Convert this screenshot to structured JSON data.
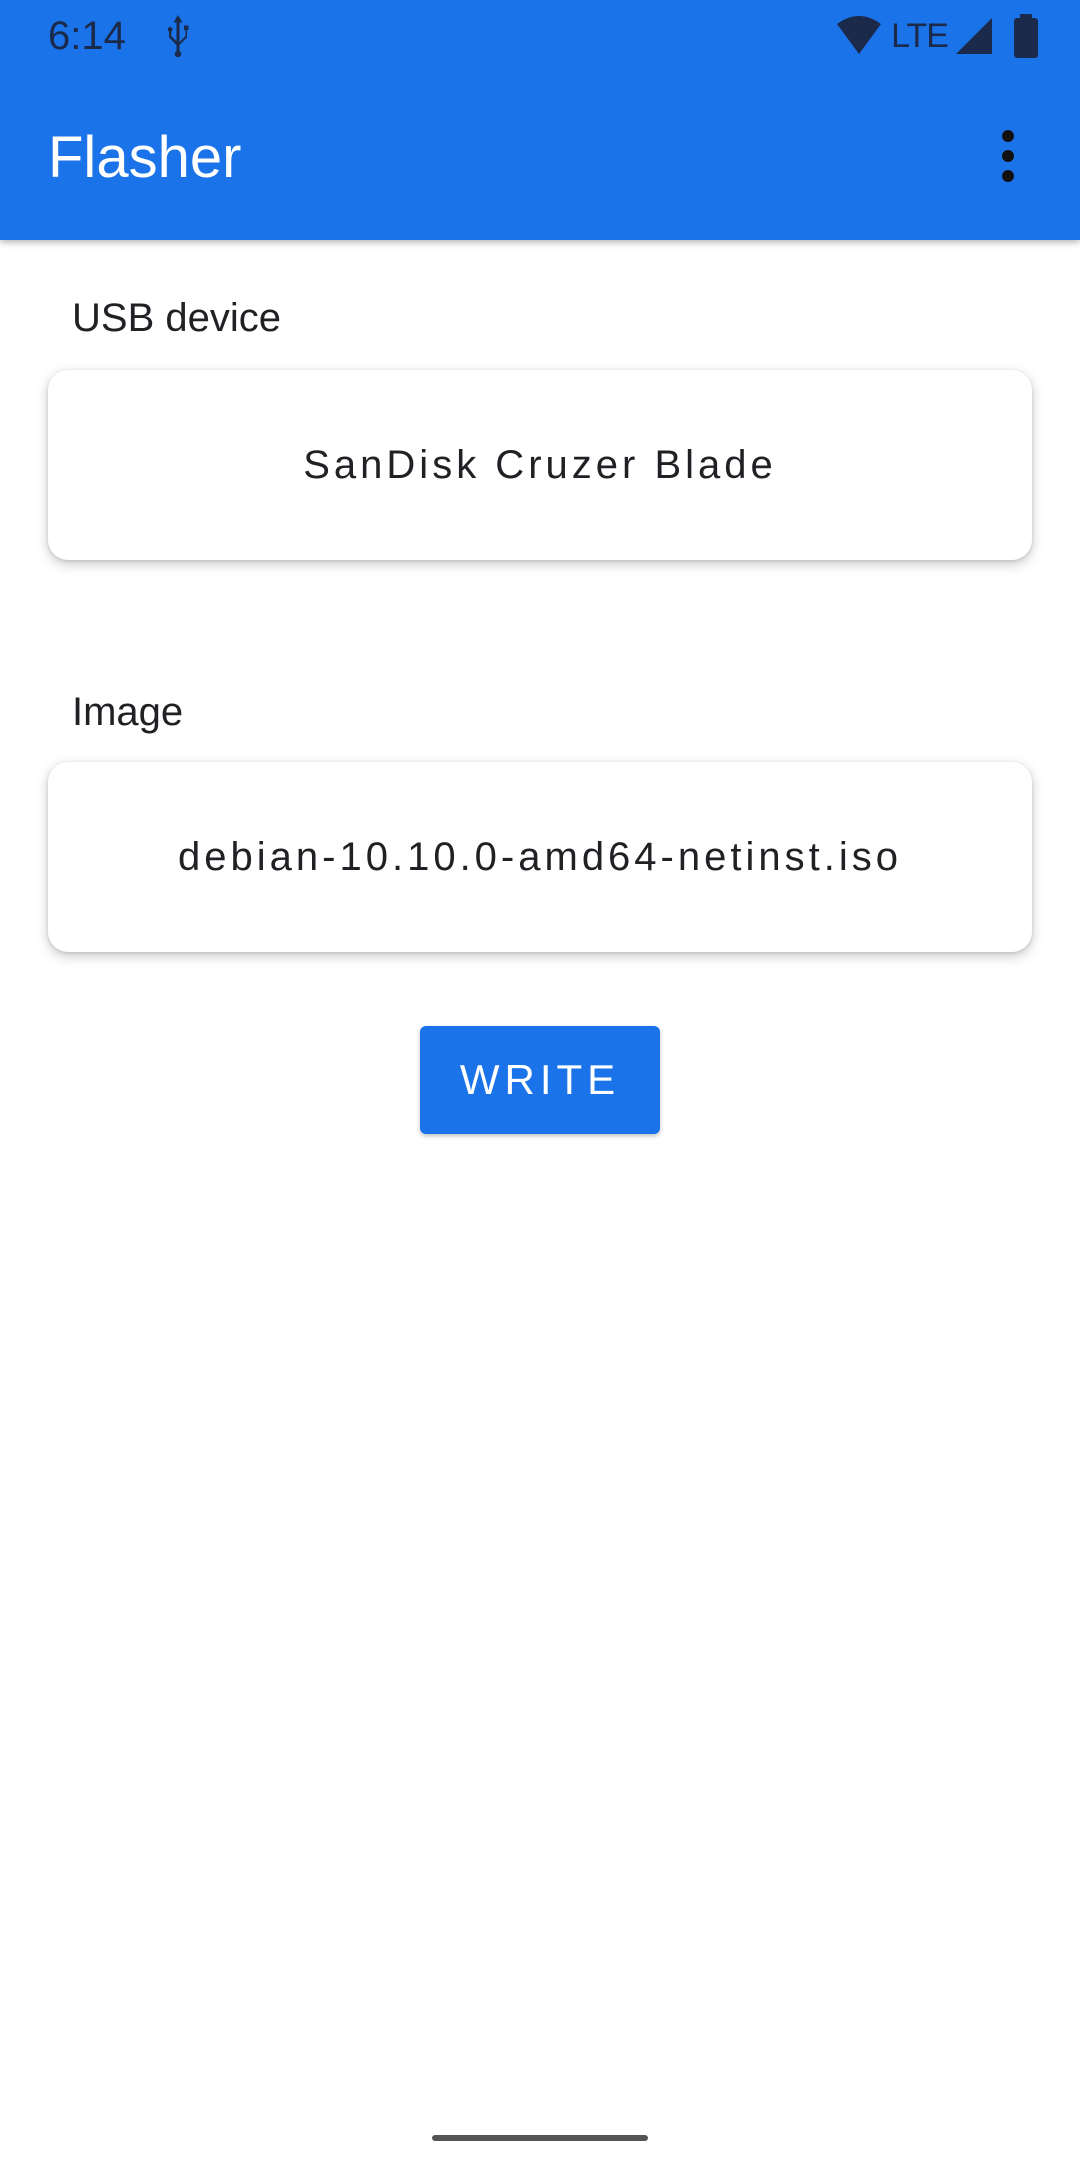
{
  "status_bar": {
    "time": "6:14",
    "network_label": "LTE",
    "icons": [
      "usb-icon",
      "wifi-icon",
      "cellular-signal-icon",
      "battery-icon"
    ]
  },
  "app_bar": {
    "title": "Flasher",
    "menu_icon": "more-vert-icon"
  },
  "usb_section": {
    "label": "USB device",
    "value": "SanDisk Cruzer Blade"
  },
  "image_section": {
    "label": "Image",
    "value": "debian-10.10.0-amd64-netinst.iso"
  },
  "actions": {
    "write_label": "WRITE"
  },
  "colors": {
    "primary": "#1a73e8",
    "status_icons": "#1b2a4a",
    "text": "#202124",
    "background": "#ffffff"
  }
}
